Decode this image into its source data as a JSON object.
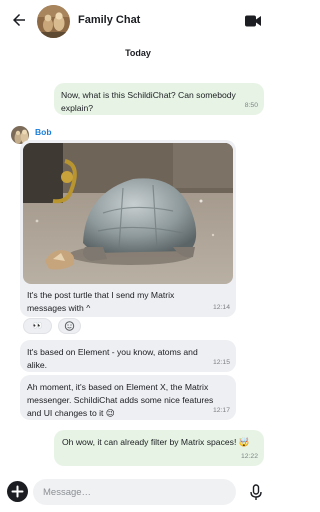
{
  "header": {
    "back_icon": "arrow-left-icon",
    "room_name": "Family Chat",
    "call_icon": "video-camera-icon"
  },
  "timeline": {
    "date_separator": "Today",
    "messages": [
      {
        "direction": "outgoing",
        "lines": [
          "Now, what is this SchildiChat? Can somebody",
          "explain?"
        ],
        "time": "8:50"
      },
      {
        "direction": "incoming",
        "sender": "Bob",
        "has_image": true,
        "image_subject": "tortoise",
        "lines": [
          "It's the post turtle that I send my Matrix",
          "messages with ^"
        ],
        "time": "12:14",
        "reactions": [
          {
            "emoji": "👀"
          }
        ],
        "add_reaction_icon": "add-reaction-icon"
      },
      {
        "direction": "incoming",
        "lines": [
          "It's based on Element - you know, atoms and",
          "alike."
        ],
        "time": "12:15"
      },
      {
        "direction": "incoming",
        "lines": [
          "Ah moment, it's based on Element X, the Matrix",
          "messenger. SchildiChat adds some nice features",
          "and UI changes to it 😉"
        ],
        "time": "12:17"
      },
      {
        "direction": "outgoing",
        "lines": [
          "Oh wow, it can already filter by Matrix spaces! 🤯"
        ],
        "time": "12:22"
      }
    ]
  },
  "composer": {
    "attach_icon": "plus-icon",
    "placeholder": "Message…",
    "value": "",
    "voice_icon": "microphone-icon"
  },
  "colors": {
    "outgoing_bubble": "#e7f4e5",
    "incoming_bubble": "#eeeff2",
    "sender_name": "#1a7dd8",
    "text": "#1b1d22",
    "timestamp": "#7d8185"
  }
}
